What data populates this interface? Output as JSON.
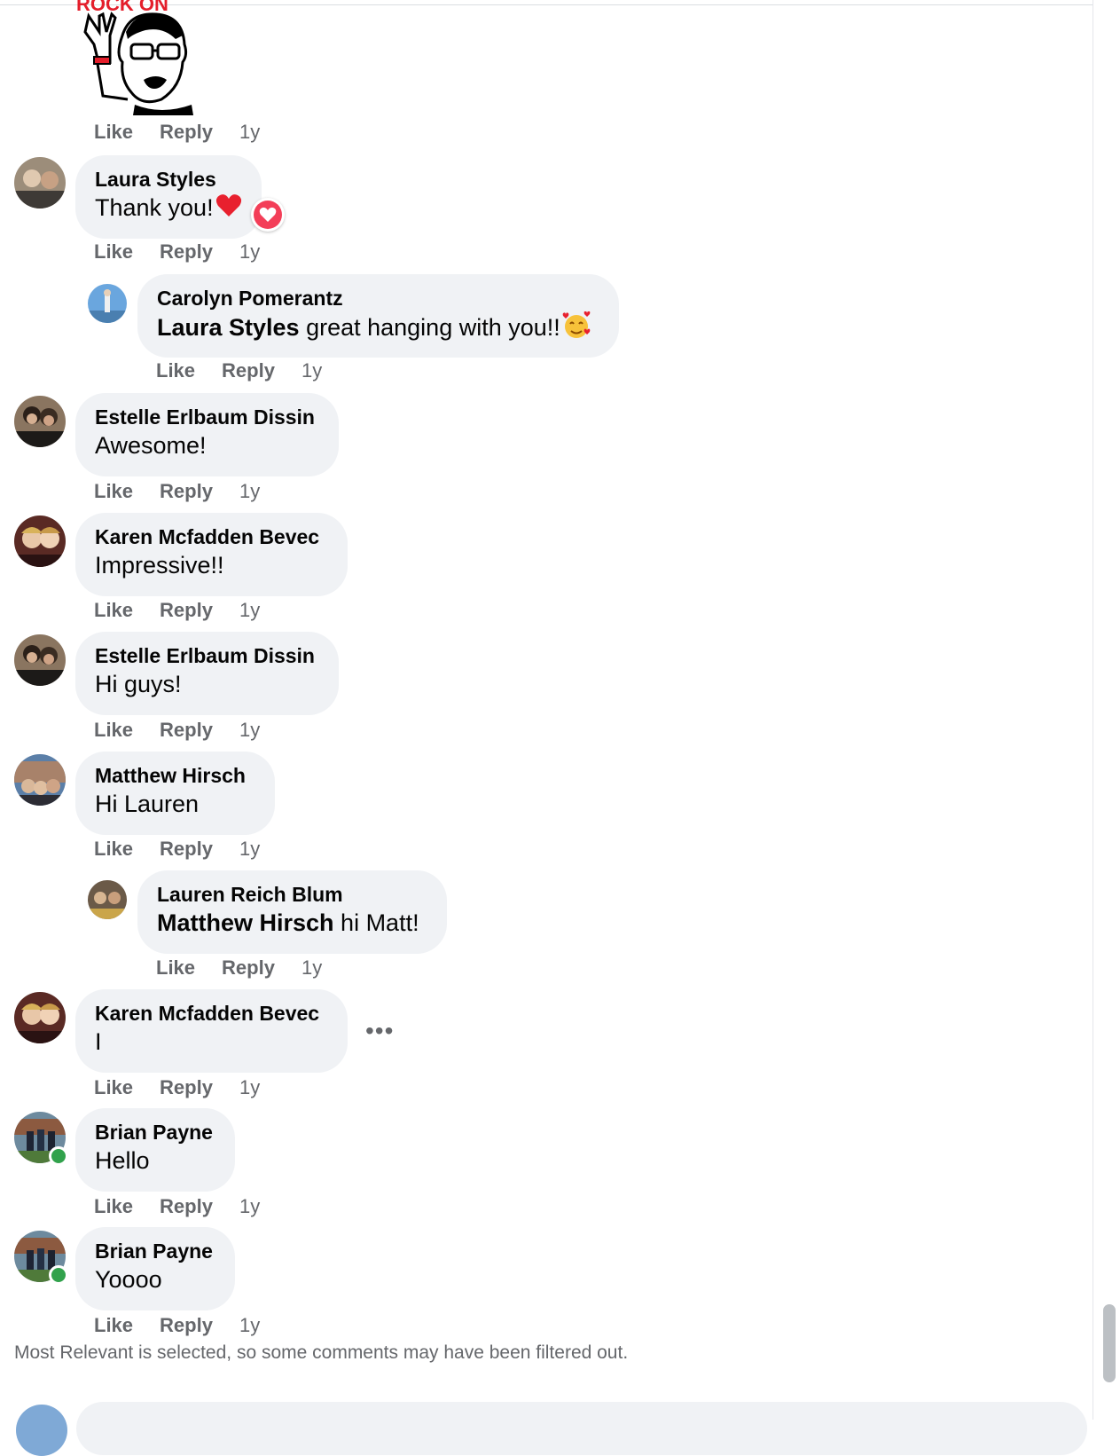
{
  "sticker": {
    "caption": "ROCK ON",
    "icon": "rock-on-sticker"
  },
  "actions": {
    "like": "Like",
    "reply": "Reply"
  },
  "comments": [
    {
      "author": "Laura Styles",
      "text": "Thank you!",
      "time": "1y",
      "reaction": "heart",
      "emoji": "red-heart"
    },
    {
      "author": "Carolyn Pomerantz",
      "mention": "Laura Styles",
      "text": " great hanging with you!!",
      "time": "1y",
      "reply": true,
      "emoji": "smiling-face-with-hearts"
    },
    {
      "author": "Estelle Erlbaum Dissin",
      "text": "Awesome!",
      "time": "1y"
    },
    {
      "author": "Karen Mcfadden Bevec",
      "text": "Impressive!!",
      "time": "1y"
    },
    {
      "author": "Estelle Erlbaum Dissin",
      "text": "Hi guys!",
      "time": "1y"
    },
    {
      "author": "Matthew Hirsch",
      "text": "Hi Lauren",
      "time": "1y"
    },
    {
      "author": "Lauren Reich Blum",
      "mention": "Matthew Hirsch",
      "text": " hi Matt!",
      "time": "1y",
      "reply": true
    },
    {
      "author": "Karen Mcfadden Bevec",
      "text": "I",
      "time": "1y",
      "more": "•••"
    },
    {
      "author": "Brian Payne",
      "text": "Hello",
      "time": "1y",
      "online": true
    },
    {
      "author": "Brian Payne",
      "text": "Yoooo",
      "time": "1y",
      "online": true
    }
  ],
  "sticker_actions": {
    "time": "1y"
  },
  "filter_note": "Most Relevant is selected, so some comments may have been filtered out.",
  "composer": {
    "placeholder": ""
  },
  "colors": {
    "bubble": "#f0f2f5",
    "secondary_text": "#65676b",
    "online": "#31a24c",
    "reaction": "#f33e58"
  }
}
